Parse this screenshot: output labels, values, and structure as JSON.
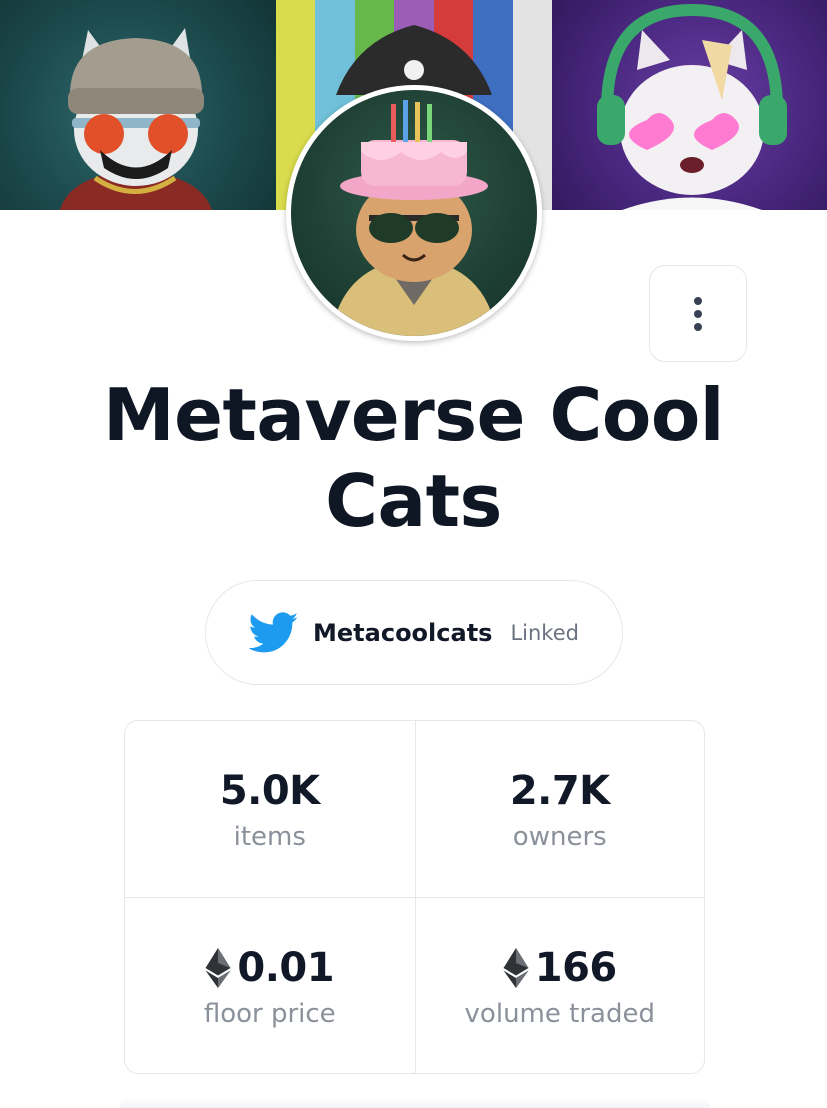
{
  "collection": {
    "title": "Metaverse Cool Cats"
  },
  "twitter": {
    "handle": "Metacoolcats",
    "status": "Linked",
    "icon": "twitter-bird-icon",
    "color": "#1d9bf0"
  },
  "menu": {
    "icon": "more-vertical-icon"
  },
  "stats": [
    {
      "value": "5.0K",
      "label": "items",
      "eth": false
    },
    {
      "value": "2.7K",
      "label": "owners",
      "eth": false
    },
    {
      "value": "0.01",
      "label": "floor price",
      "eth": true
    },
    {
      "value": "166",
      "label": "volume traded",
      "eth": true
    }
  ],
  "banner": {
    "stripe_colors": [
      "#d9dc4c",
      "#6fc0d8",
      "#66b84a",
      "#9b5db5",
      "#d63b3b",
      "#3f6fc1",
      "#e3e3e3"
    ]
  }
}
